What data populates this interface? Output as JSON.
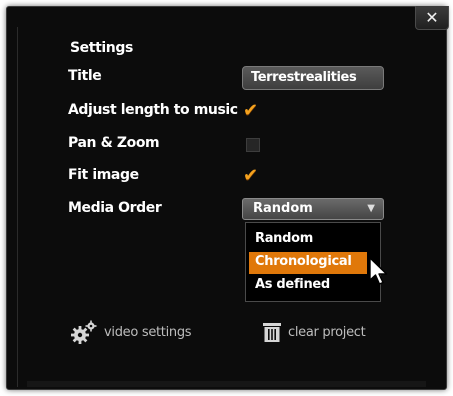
{
  "dialog": {
    "close_glyph": "✕",
    "heading": "Settings"
  },
  "fields": {
    "title_label": "Title",
    "title_value": "Terrestrealities",
    "adjust_label": "Adjust length to music",
    "adjust_checked": true,
    "panzoom_label": "Pan & Zoom",
    "panzoom_checked": false,
    "fit_label": "Fit image",
    "fit_checked": true,
    "order_label": "Media Order",
    "order_value": "Random"
  },
  "dropdown": {
    "options": [
      "Random",
      "Chronological",
      "As defined"
    ],
    "highlighted_index": 1
  },
  "footer": {
    "video_settings_label": "video settings",
    "clear_project_label": "clear project"
  },
  "colors": {
    "accent": "#e0780a",
    "check": "#f5a21e",
    "background": "#0c0c0c"
  },
  "icons": {
    "close": "close-icon",
    "check": "checkmark-icon",
    "dropdown_arrow": "triangle-down-icon",
    "video_settings": "gears-icon",
    "clear_project": "trash-icon",
    "cursor": "mouse-pointer-icon"
  },
  "check_glyph": "✔",
  "arrow_glyph": "▼"
}
